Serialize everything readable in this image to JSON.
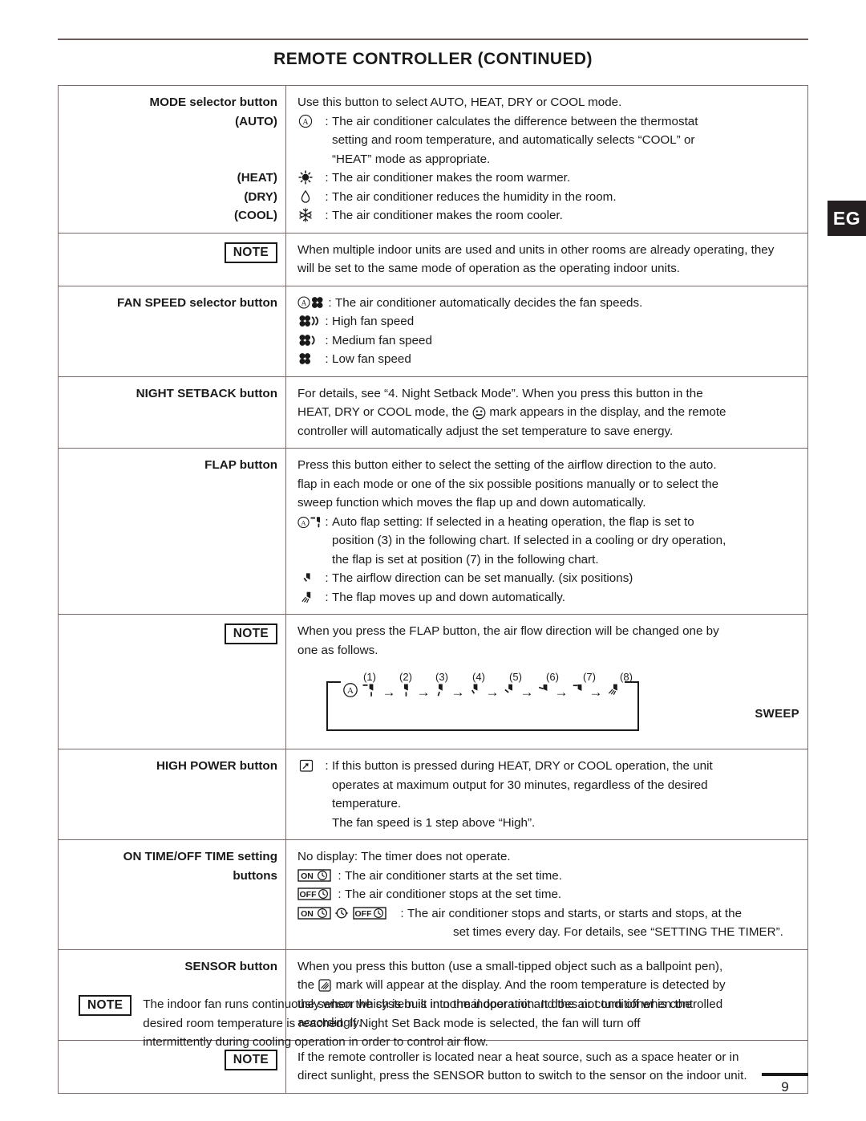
{
  "page": {
    "title": "REMOTE CONTROLLER (CONTINUED)",
    "edge_tab": "EG",
    "page_number": "9"
  },
  "note_label": "NOTE",
  "colon": ":",
  "rows": {
    "mode": {
      "label": "MODE selector button",
      "labels_extra": [
        "(AUTO)",
        "(HEAT)",
        "(DRY)",
        "(COOL)"
      ],
      "intro": "Use this button to select AUTO, HEAT, DRY or COOL mode.",
      "auto_text_1": "The air conditioner calculates the difference between the thermostat",
      "auto_text_2": "setting and room temperature, and automatically selects “COOL” or",
      "auto_text_3": "“HEAT” mode as appropriate.",
      "heat_text": "The air conditioner makes the room warmer.",
      "dry_text": "The air conditioner reduces the humidity in the room.",
      "cool_text": "The air conditioner makes the room cooler.",
      "note_1": "When multiple indoor units are used and units in other rooms are already operating, they",
      "note_2": "will be set to the same mode of operation as the operating indoor units."
    },
    "fan_speed": {
      "label": "FAN SPEED selector button",
      "auto_text": "The air conditioner automatically decides the fan speeds.",
      "high_text": "High fan speed",
      "medium_text": "Medium fan speed",
      "low_text": "Low fan speed"
    },
    "night_setback": {
      "label": "NIGHT SETBACK button",
      "text_1": "For details, see “4. Night Setback Mode”. When you press this button in the",
      "text_2a": "HEAT, DRY or COOL mode, the",
      "text_2b": "mark appears in the display, and the remote",
      "text_3": "controller will automatically adjust the set temperature to save energy."
    },
    "flap": {
      "label": "FLAP button",
      "text_1": "Press this button either to select the setting of the airflow direction to the auto.",
      "text_2": "flap in each mode or one of the six possible positions manually or to select the",
      "text_3": "sweep function which moves the flap up and down automatically.",
      "auto_1": "Auto flap setting: If selected in a heating operation, the flap is set to",
      "auto_2": "position (3) in the following chart. If selected in a cooling or dry operation,",
      "auto_3": "the flap is set at position (7) in the following chart.",
      "manual_text": "The airflow direction can be set manually. (six positions)",
      "sweep_text": "The flap moves up and down automatically.",
      "note_1": "When you press the FLAP button, the air flow direction will be changed one by",
      "note_2": "one as follows.",
      "chart": {
        "auto_symbol": "A",
        "sweep_label": "SWEEP",
        "arrow": "→",
        "positions": [
          "(1)",
          "(2)",
          "(3)",
          "(4)",
          "(5)",
          "(6)",
          "(7)",
          "(8)"
        ]
      }
    },
    "high_power": {
      "label": "HIGH POWER button",
      "text_1": "If this button is pressed during HEAT, DRY or COOL operation, the unit",
      "text_2": "operates at maximum output for 30 minutes, regardless of the desired",
      "text_3": "temperature.",
      "text_4": "The fan speed is 1 step above “High”."
    },
    "timer": {
      "label_1": "ON TIME/OFF TIME setting",
      "label_2": "buttons",
      "no_display": "No display: The timer does not operate.",
      "on_text": "The air conditioner starts at the set time.",
      "off_text": "The air conditioner stops at the set time.",
      "both_text_1": "The air conditioner stops and starts, or starts and stops, at the",
      "both_text_2": "set times every day. For details, see “SETTING THE TIMER”.",
      "on_label": "ON",
      "off_label": "OFF"
    },
    "sensor": {
      "label": "SENSOR button",
      "text_1": "When you press this button (use a small-tipped object such as a ballpoint pen),",
      "text_2a": "the",
      "text_2b": "mark will appear at the display. And the room temperature is detected by",
      "text_3": "the sensor which is built into the indoor unit and the air conditioner is controlled",
      "text_4": "accordingly.",
      "note_1": "If the remote controller is located near a heat source, such as a space heater or in",
      "note_2": "direct sunlight, press the SENSOR button to switch to the sensor on the indoor unit."
    }
  },
  "bottom_note": {
    "line_1": "The indoor fan runs continuously when the system is in normal operation. It does not turn off when the",
    "line_2": "desired room temperature is reached. If Night Set Back mode is selected, the fan will turn off",
    "line_3": "intermittently during cooling operation in order to control air flow."
  },
  "colors": {
    "text": "#1a1a1a",
    "rule": "#6b5a5a",
    "tab_bg": "#231f20"
  }
}
